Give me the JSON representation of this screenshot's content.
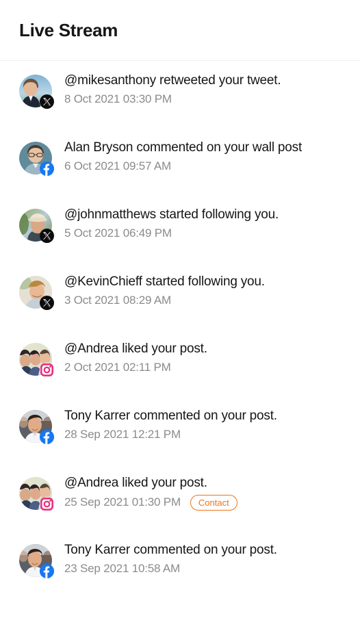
{
  "header": {
    "title": "Live Stream"
  },
  "colors": {
    "accent_orange": "#F07316",
    "x_black": "#0C0C0C",
    "facebook_blue": "#1877F2",
    "instagram_pink": "#E8307E",
    "text_primary": "#151515",
    "text_muted": "#8B8B8B",
    "divider": "#F0F0F1",
    "background": "#FFFFFF"
  },
  "feed": {
    "items": [
      {
        "text": "@mikesanthony retweeted your tweet.",
        "time": "8 Oct 2021 03:30 PM",
        "network": "x",
        "badge_icon": "x-icon",
        "avatar": "avatar-mikesanthony",
        "tag": null
      },
      {
        "text": "Alan Bryson commented on your wall post",
        "time": "6 Oct 2021 09:57 AM",
        "network": "facebook",
        "badge_icon": "facebook-icon",
        "avatar": "avatar-alan-bryson",
        "tag": null
      },
      {
        "text": "@johnmatthews started following you.",
        "time": "5 Oct 2021 06:49 PM",
        "network": "x",
        "badge_icon": "x-icon",
        "avatar": "avatar-johnmatthews",
        "tag": null
      },
      {
        "text": "@KevinChieff started following you.",
        "time": "3 Oct 2021 08:29 AM",
        "network": "x",
        "badge_icon": "x-icon",
        "avatar": "avatar-kevinchieff",
        "tag": null
      },
      {
        "text": "@Andrea liked your post.",
        "time": "2 Oct 2021 02:11 PM",
        "network": "instagram",
        "badge_icon": "instagram-icon",
        "avatar": "avatar-andrea",
        "tag": null
      },
      {
        "text": "Tony Karrer commented on your post.",
        "time": "28 Sep 2021 12:21 PM",
        "network": "facebook",
        "badge_icon": "facebook-icon",
        "avatar": "avatar-tony-karrer",
        "tag": null
      },
      {
        "text": "@Andrea liked your post.",
        "time": "25 Sep 2021 01:30 PM",
        "network": "instagram",
        "badge_icon": "instagram-icon",
        "avatar": "avatar-andrea",
        "tag": "Contact"
      },
      {
        "text": "Tony Karrer commented on your post.",
        "time": "23 Sep 2021 10:58 AM",
        "network": "facebook",
        "badge_icon": "facebook-icon",
        "avatar": "avatar-tony-karrer",
        "tag": null
      }
    ]
  }
}
